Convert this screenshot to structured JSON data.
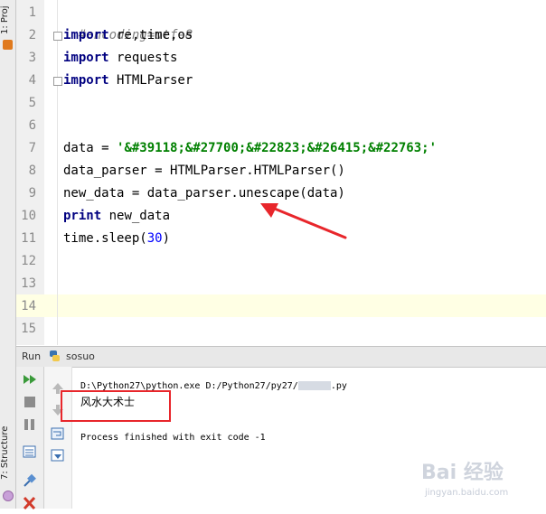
{
  "side_tabs": {
    "project": "1: Proj",
    "structure": "7: Structure"
  },
  "editor": {
    "line_numbers": [
      "1",
      "2",
      "3",
      "4",
      "5",
      "6",
      "7",
      "8",
      "9",
      "10",
      "11",
      "12",
      "13",
      "14",
      "15"
    ],
    "lines": {
      "l1_comment": "#encoding=utf-8",
      "l2_kw": "import",
      "l2_rest": " re,time,os",
      "l3_kw": "import",
      "l3_rest": " requests",
      "l4_kw": "import",
      "l4_rest": " HTMLParser",
      "l7_a": "data = ",
      "l7_str": "'&#39118;&#27700;&#22823;&#26415;&#22763;'",
      "l8": "data_parser = HTMLParser.HTMLParser()",
      "l9": "new_data = data_parser.unescape(data)",
      "l10_kw": "print",
      "l10_rest": " new_data",
      "l11_a": "time.sleep(",
      "l11_num": "30",
      "l11_b": ")"
    }
  },
  "run": {
    "header_label": "Run",
    "config_name": "sosuo",
    "output": {
      "command": "D:\\Python27\\python.exe D:/Python27/py27/",
      "command_tail": ".py",
      "result": "风水大术士",
      "finished": "Process finished with exit code -1"
    }
  },
  "watermark": {
    "brand": "Bai 经验",
    "url": "jingyan.baidu.com"
  },
  "colors": {
    "annotation_red": "#e8262b",
    "keyword": "#000080",
    "string": "#008000",
    "number": "#0000ff"
  }
}
